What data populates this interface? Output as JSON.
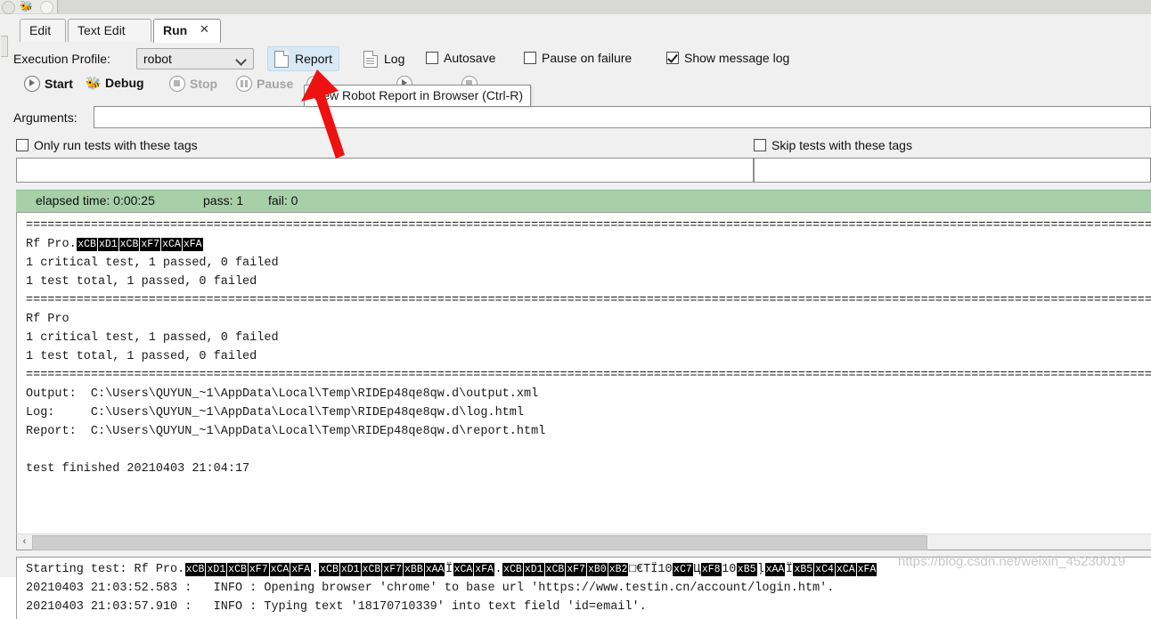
{
  "window": {
    "tabs": [
      {
        "label": "Edit",
        "active": false,
        "closable": false
      },
      {
        "label": "Text Edit",
        "active": false,
        "closable": false
      },
      {
        "label": "Run",
        "active": true,
        "closable": true
      }
    ],
    "tab_close_glyph": "✕"
  },
  "toolbar": {
    "execution_profile_label": "Execution Profile:",
    "profile_value": "robot",
    "report_label": "Report",
    "log_label": "Log",
    "autosave_label": "Autosave",
    "pause_on_failure_label": "Pause on failure",
    "show_message_log_label": "Show message log",
    "autosave_checked": false,
    "pause_on_failure_checked": false,
    "show_message_log_checked": true
  },
  "controls": {
    "start_label": "Start",
    "debug_label": "Debug",
    "stop_label": "Stop",
    "pause_label": "Pause",
    "start_enabled": true,
    "debug_enabled": true,
    "stop_enabled": false,
    "pause_enabled": false
  },
  "tooltip": {
    "text": "View Robot Report in Browser (Ctrl-R)"
  },
  "arguments": {
    "label": "Arguments:",
    "value": "",
    "placeholder": ""
  },
  "tags": {
    "include_label": "Only run tests with these tags",
    "exclude_label": "Skip tests with these tags",
    "include_checked": false,
    "exclude_checked": false,
    "include_value": "",
    "exclude_value": ""
  },
  "status": {
    "elapsed": "elapsed time: 0:00:25",
    "pass": "pass: 1",
    "fail": "fail: 0",
    "color": "#a8d0a8"
  },
  "console": {
    "separator": "==============================================================================",
    "lines": [
      {
        "type": "separator"
      },
      {
        "type": "suite",
        "prefix": "Rf Pro.",
        "escapes": [
          "xCB",
          "xD1",
          "xCB",
          "xF7",
          "xCA",
          "xFA"
        ],
        "suffix": ""
      },
      {
        "type": "text",
        "text": "1 critical test, 1 passed, 0 failed"
      },
      {
        "type": "text",
        "text": "1 test total, 1 passed, 0 failed"
      },
      {
        "type": "separator"
      },
      {
        "type": "text",
        "text": "Rf Pro"
      },
      {
        "type": "text",
        "text": "1 critical test, 1 passed, 0 failed"
      },
      {
        "type": "text",
        "text": "1 test total, 1 passed, 0 failed"
      },
      {
        "type": "separator"
      },
      {
        "type": "text",
        "text": "Output:  C:\\Users\\QUYUN_~1\\AppData\\Local\\Temp\\RIDEp48qe8qw.d\\output.xml"
      },
      {
        "type": "text",
        "text": "Log:     C:\\Users\\QUYUN_~1\\AppData\\Local\\Temp\\RIDEp48qe8qw.d\\log.html"
      },
      {
        "type": "text",
        "text": "Report:  C:\\Users\\QUYUN_~1\\AppData\\Local\\Temp\\RIDEp48qe8qw.d\\report.html"
      },
      {
        "type": "blank"
      },
      {
        "type": "text",
        "text": "test finished 20210403 21:04:17"
      }
    ],
    "scroll_left_glyph": "‹"
  },
  "message_log": {
    "starting_prefix": "Starting test: Rf Pro.",
    "starting_tokens": [
      {
        "k": "esc",
        "v": "xCB"
      },
      {
        "k": "esc",
        "v": "xD1"
      },
      {
        "k": "esc",
        "v": "xCB"
      },
      {
        "k": "esc",
        "v": "xF7"
      },
      {
        "k": "esc",
        "v": "xCA"
      },
      {
        "k": "esc",
        "v": "xFA"
      },
      {
        "k": "txt",
        "v": "."
      },
      {
        "k": "esc",
        "v": "xCB"
      },
      {
        "k": "esc",
        "v": "xD1"
      },
      {
        "k": "esc",
        "v": "xCB"
      },
      {
        "k": "esc",
        "v": "xF7"
      },
      {
        "k": "esc",
        "v": "xBB"
      },
      {
        "k": "esc",
        "v": "xAA"
      },
      {
        "k": "moji",
        "v": "Ï"
      },
      {
        "k": "esc",
        "v": "xCA"
      },
      {
        "k": "esc",
        "v": "xFA"
      },
      {
        "k": "txt",
        "v": "."
      },
      {
        "k": "esc",
        "v": "xCB"
      },
      {
        "k": "esc",
        "v": "xD1"
      },
      {
        "k": "esc",
        "v": "xCB"
      },
      {
        "k": "esc",
        "v": "xF7"
      },
      {
        "k": "esc",
        "v": "xB0"
      },
      {
        "k": "esc",
        "v": "xB2"
      },
      {
        "k": "moji",
        "v": "□€TÏ10"
      },
      {
        "k": "esc",
        "v": "xC7"
      },
      {
        "k": "moji",
        "v": "Ц"
      },
      {
        "k": "esc",
        "v": "xF8"
      },
      {
        "k": "moji",
        "v": "10"
      },
      {
        "k": "esc",
        "v": "xB5"
      },
      {
        "k": "moji",
        "v": "ļ"
      },
      {
        "k": "esc",
        "v": "xAA"
      },
      {
        "k": "moji",
        "v": "Ï"
      },
      {
        "k": "esc",
        "v": "xB5"
      },
      {
        "k": "esc",
        "v": "xC4"
      },
      {
        "k": "esc",
        "v": "xCA"
      },
      {
        "k": "esc",
        "v": "xFA"
      }
    ],
    "rows": [
      "20210403 21:03:52.583 :   INFO : Opening browser 'chrome' to base url 'https://www.testin.cn/account/login.htm'.",
      "20210403 21:03:57.910 :   INFO : Typing text '18170710339' into text field 'id=email'."
    ]
  },
  "watermark": {
    "text": "https://blog.csdn.net/weixin_45230019"
  }
}
